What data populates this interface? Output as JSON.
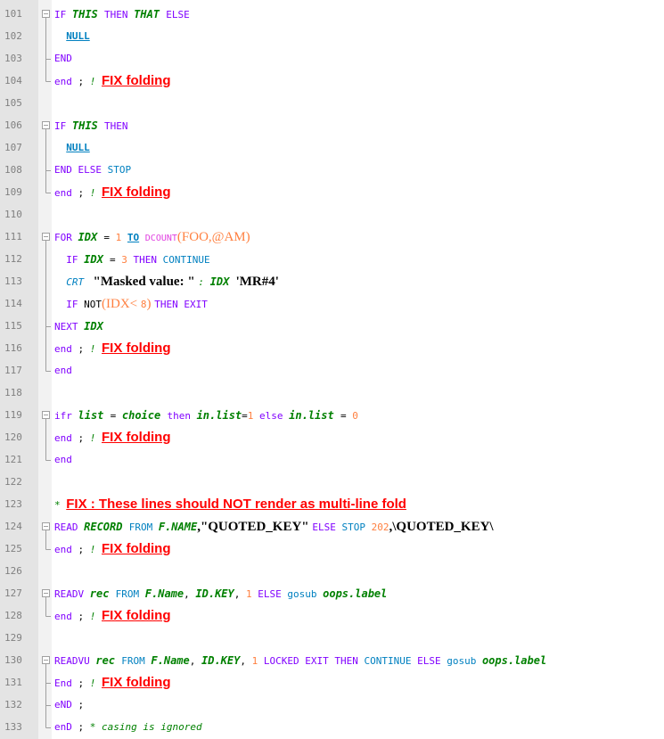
{
  "editor": {
    "lines": [
      {
        "n": "101",
        "fold": "start",
        "code": [
          [
            "kw",
            "IF "
          ],
          [
            "var",
            "THIS "
          ],
          [
            "kw",
            "THEN "
          ],
          [
            "var",
            "THAT "
          ],
          [
            "kw",
            "ELSE"
          ]
        ]
      },
      {
        "n": "102",
        "fold": "mid",
        "code": [
          [
            "txt",
            "  "
          ],
          [
            "null",
            "NULL"
          ]
        ]
      },
      {
        "n": "103",
        "fold": "mid-end",
        "code": [
          [
            "kw",
            "END"
          ]
        ]
      },
      {
        "n": "104",
        "fold": "end",
        "code": [
          [
            "kw",
            "end "
          ],
          [
            "txt",
            "; "
          ],
          [
            "cmt",
            "! "
          ],
          [
            "fix",
            "FIX folding"
          ]
        ]
      },
      {
        "n": "105",
        "fold": "",
        "code": []
      },
      {
        "n": "106",
        "fold": "start",
        "code": [
          [
            "kw",
            "IF "
          ],
          [
            "var",
            "THIS "
          ],
          [
            "kw",
            "THEN"
          ]
        ]
      },
      {
        "n": "107",
        "fold": "mid",
        "code": [
          [
            "txt",
            "  "
          ],
          [
            "null",
            "NULL"
          ]
        ]
      },
      {
        "n": "108",
        "fold": "mid-end",
        "code": [
          [
            "kw",
            "END ELSE "
          ],
          [
            "kwb",
            "STOP"
          ]
        ]
      },
      {
        "n": "109",
        "fold": "end",
        "code": [
          [
            "kw",
            "end "
          ],
          [
            "txt",
            "; "
          ],
          [
            "cmt",
            "! "
          ],
          [
            "fix",
            "FIX folding"
          ]
        ]
      },
      {
        "n": "110",
        "fold": "",
        "code": []
      },
      {
        "n": "111",
        "fold": "start",
        "code": [
          [
            "kw",
            "FOR "
          ],
          [
            "var",
            "IDX "
          ],
          [
            "txt",
            "= "
          ],
          [
            "num",
            "1 "
          ],
          [
            "to",
            "TO"
          ],
          [
            "txt",
            " "
          ],
          [
            "fn",
            "DCOUNT"
          ],
          [
            "paren",
            "(FOO,@AM)"
          ]
        ]
      },
      {
        "n": "112",
        "fold": "mid",
        "code": [
          [
            "txt",
            "  "
          ],
          [
            "kw",
            "IF "
          ],
          [
            "var",
            "IDX "
          ],
          [
            "txt",
            "= "
          ],
          [
            "num",
            "3 "
          ],
          [
            "kw",
            "THEN "
          ],
          [
            "kwb",
            "CONTINUE"
          ]
        ]
      },
      {
        "n": "113",
        "fold": "mid",
        "code": [
          [
            "txt",
            "  "
          ],
          [
            "kwb it",
            "CRT "
          ],
          [
            "str",
            " \"Masked value: \" "
          ],
          [
            "cmt",
            ": "
          ],
          [
            "var",
            "IDX "
          ],
          [
            "str",
            "'MR#4'"
          ]
        ]
      },
      {
        "n": "114",
        "fold": "mid",
        "code": [
          [
            "txt",
            "  "
          ],
          [
            "kw",
            "IF "
          ],
          [
            "txt",
            "NOT"
          ],
          [
            "paren",
            "(IDX< "
          ],
          [
            "num",
            "8"
          ],
          [
            "paren",
            ") "
          ],
          [
            "kw",
            "THEN "
          ],
          [
            "kw",
            "EXIT"
          ]
        ]
      },
      {
        "n": "115",
        "fold": "mid-end",
        "code": [
          [
            "kw",
            "NEXT "
          ],
          [
            "var",
            "IDX"
          ]
        ]
      },
      {
        "n": "116",
        "fold": "mid",
        "code": [
          [
            "kw",
            "end "
          ],
          [
            "txt",
            "; "
          ],
          [
            "cmt",
            "! "
          ],
          [
            "fix",
            "FIX folding"
          ]
        ]
      },
      {
        "n": "117",
        "fold": "end",
        "code": [
          [
            "kw",
            "end"
          ]
        ]
      },
      {
        "n": "118",
        "fold": "",
        "code": []
      },
      {
        "n": "119",
        "fold": "start",
        "code": [
          [
            "ifr",
            "ifr "
          ],
          [
            "var",
            "list "
          ],
          [
            "txt",
            "= "
          ],
          [
            "var",
            "choice "
          ],
          [
            "kw",
            "then "
          ],
          [
            "var",
            "in.list"
          ],
          [
            "txt",
            "="
          ],
          [
            "num",
            "1 "
          ],
          [
            "kw",
            "else "
          ],
          [
            "var",
            "in.list "
          ],
          [
            "txt",
            "= "
          ],
          [
            "num",
            "0"
          ]
        ]
      },
      {
        "n": "120",
        "fold": "mid",
        "code": [
          [
            "kw",
            "end "
          ],
          [
            "txt",
            "; "
          ],
          [
            "cmt",
            "! "
          ],
          [
            "fix",
            "FIX folding"
          ]
        ]
      },
      {
        "n": "121",
        "fold": "end",
        "code": [
          [
            "kw",
            "end"
          ]
        ]
      },
      {
        "n": "122",
        "fold": "",
        "code": []
      },
      {
        "n": "123",
        "fold": "",
        "code": [
          [
            "cmt",
            "* "
          ],
          [
            "fix",
            "FIX : These lines should NOT render as multi-line fold"
          ]
        ]
      },
      {
        "n": "124",
        "fold": "start",
        "code": [
          [
            "kw",
            "READ "
          ],
          [
            "var",
            "RECORD "
          ],
          [
            "kwb",
            "FROM "
          ],
          [
            "var",
            "F.NAME"
          ],
          [
            "str",
            ",\"QUOTED_KEY\" "
          ],
          [
            "kw",
            "ELSE "
          ],
          [
            "kwb",
            "STOP "
          ],
          [
            "num",
            "202"
          ],
          [
            "str",
            ",\\QUOTED_KEY\\"
          ]
        ]
      },
      {
        "n": "125",
        "fold": "end",
        "code": [
          [
            "kw",
            "end "
          ],
          [
            "txt",
            "; "
          ],
          [
            "cmt",
            "! "
          ],
          [
            "fix",
            "FIX folding"
          ]
        ]
      },
      {
        "n": "126",
        "fold": "",
        "code": []
      },
      {
        "n": "127",
        "fold": "start",
        "code": [
          [
            "kw",
            "READV "
          ],
          [
            "var",
            "rec "
          ],
          [
            "kwb",
            "FROM "
          ],
          [
            "var",
            "F.Name"
          ],
          [
            "txt",
            ", "
          ],
          [
            "var",
            "ID.KEY"
          ],
          [
            "txt",
            ", "
          ],
          [
            "num",
            "1 "
          ],
          [
            "kw",
            "ELSE "
          ],
          [
            "kwb",
            "gosub "
          ],
          [
            "var",
            "oops.label"
          ]
        ]
      },
      {
        "n": "128",
        "fold": "end",
        "code": [
          [
            "kw",
            "end "
          ],
          [
            "txt",
            "; "
          ],
          [
            "cmt",
            "! "
          ],
          [
            "fix",
            "FIX folding"
          ]
        ]
      },
      {
        "n": "129",
        "fold": "",
        "code": []
      },
      {
        "n": "130",
        "fold": "start",
        "code": [
          [
            "kw",
            "READVU "
          ],
          [
            "var",
            "rec "
          ],
          [
            "kwb",
            "FROM "
          ],
          [
            "var",
            "F.Name"
          ],
          [
            "txt",
            ", "
          ],
          [
            "var",
            "ID.KEY"
          ],
          [
            "txt",
            ", "
          ],
          [
            "num",
            "1 "
          ],
          [
            "kw",
            "LOCKED "
          ],
          [
            "kw",
            "EXIT "
          ],
          [
            "kw",
            "THEN "
          ],
          [
            "kwb",
            "CONTINUE "
          ],
          [
            "kw",
            "ELSE "
          ],
          [
            "kwb",
            "gosub "
          ],
          [
            "var",
            "oops.label"
          ]
        ]
      },
      {
        "n": "131",
        "fold": "mid-end",
        "code": [
          [
            "kw",
            "End "
          ],
          [
            "txt",
            "; "
          ],
          [
            "cmt",
            "! "
          ],
          [
            "fix",
            "FIX folding"
          ]
        ]
      },
      {
        "n": "132",
        "fold": "mid-end",
        "code": [
          [
            "kw",
            "eND "
          ],
          [
            "txt",
            ";"
          ]
        ]
      },
      {
        "n": "133",
        "fold": "end",
        "code": [
          [
            "kw",
            "enD "
          ],
          [
            "txt",
            "; "
          ],
          [
            "cmt",
            "* casing is ignored"
          ]
        ]
      }
    ]
  }
}
